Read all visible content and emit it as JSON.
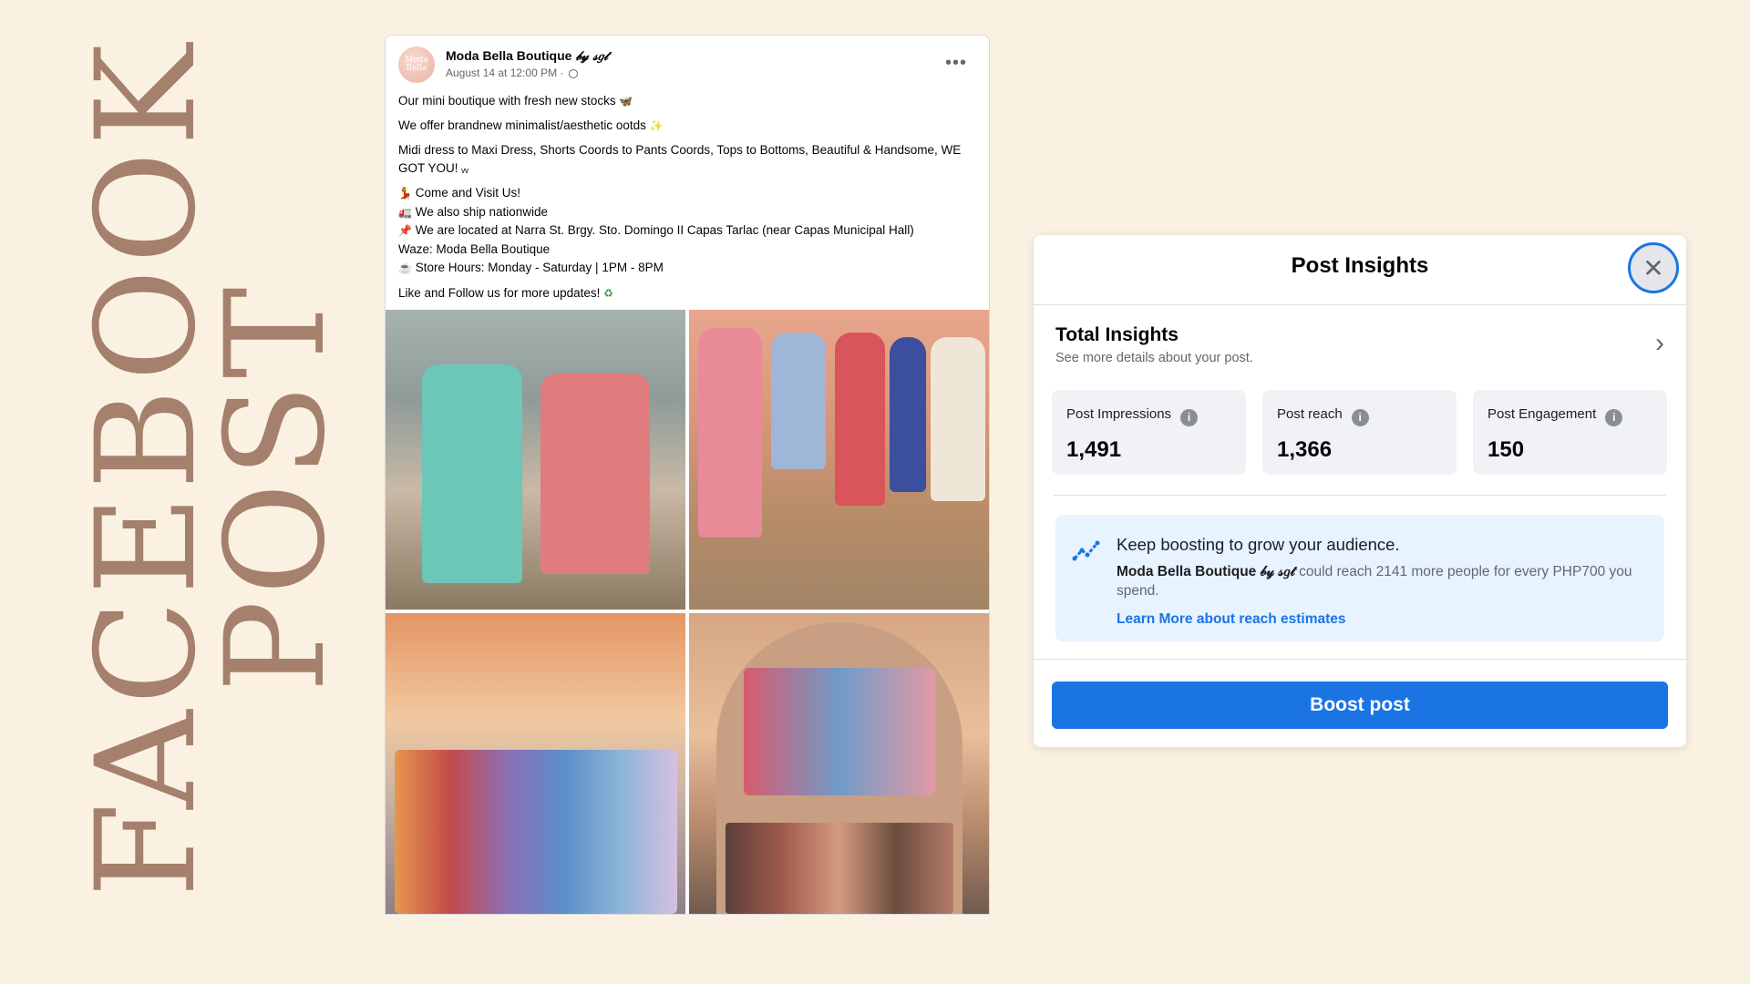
{
  "title": {
    "line1": "FACEBOOK",
    "line2": "POST"
  },
  "post": {
    "page_name": "Moda Bella Boutique",
    "page_name_suffix": "𝒷𝓎 𝓈𝑔𝓉",
    "timestamp": "August 14 at 12:00 PM ·",
    "avatar_text": "Moda Bella",
    "more_icon": "•••",
    "lines": {
      "l1": "Our mini boutique with fresh new stocks",
      "l2": "We offer brandnew minimalist/aesthetic ootds",
      "l3": "Midi dress to Maxi Dress,  Shorts Coords to Pants Coords,  Tops to Bottoms, Beautiful & Handsome, WE GOT YOU!",
      "l4": "Come and Visit Us!",
      "l5": "We also ship nationwide",
      "l6": "We are located at Narra St. Brgy. Sto. Domingo II Capas Tarlac (near Capas Municipal Hall)",
      "l7": "Waze: Moda Bella Boutique",
      "l8": "Store Hours: Monday -  Saturday | 1PM -  8PM",
      "l9": "Like and Follow us for more updates!"
    },
    "emojis": {
      "e1": "🦋",
      "e2": "✨",
      "e3": "ᵥᵥ",
      "e4": "💃",
      "e5": "🚛",
      "e6": "📌",
      "e7": "☕",
      "e8": "♻"
    }
  },
  "insights": {
    "title": "Post Insights",
    "close_icon": "✕",
    "total_title": "Total Insights",
    "total_sub": "See more details about your post.",
    "chevron": "›",
    "stats": [
      {
        "label": "Post Impressions",
        "value": "1,491"
      },
      {
        "label": "Post reach",
        "value": "1,366"
      },
      {
        "label": "Post Engagement",
        "value": "150"
      }
    ],
    "info_icon": "i",
    "tip_title": "Keep boosting to grow your audience.",
    "tip_name": "Moda Bella Boutique 𝒷𝓎 𝓈𝑔𝓉",
    "tip_text": " could reach 2141 more people for every PHP700 you spend.",
    "tip_link": "Learn More about reach estimates",
    "boost_label": "Boost post"
  },
  "colors": {
    "background": "#faf1e3",
    "title_color": "#a5806c",
    "accent": "#1b74e4"
  }
}
